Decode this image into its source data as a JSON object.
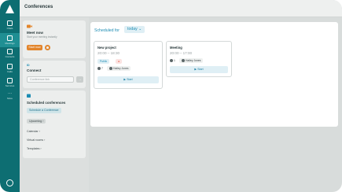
{
  "app": {
    "title": "Conferences"
  },
  "rail": {
    "items": [
      {
        "icon": "chat-icon",
        "label": "Chats"
      },
      {
        "icon": "calendar-icon",
        "label": "Meetings"
      },
      {
        "icon": "contacts-icon",
        "label": "Contacts"
      },
      {
        "icon": "calls-icon",
        "label": "Calls"
      },
      {
        "icon": "clipboard-icon",
        "label": "Services"
      },
      {
        "icon": "more-icon",
        "label": "More"
      }
    ]
  },
  "meet_now": {
    "title": "Meet now",
    "subtitle": "Start your meeting instantly",
    "start_label": "Start now"
  },
  "connect": {
    "id_label": "ID",
    "title": "Connect",
    "placeholder": "Conference link"
  },
  "scheduled": {
    "title": "Scheduled conferences",
    "schedule_button": "Schedule a Conference",
    "categories": [
      {
        "label": "Upcoming",
        "arrow": "›"
      },
      {
        "label": "Calendar",
        "arrow": "›"
      },
      {
        "label": "Virtual rooms",
        "arrow": "›"
      },
      {
        "label": "Templates",
        "arrow": "›"
      }
    ]
  },
  "main": {
    "scheduled_for": "Scheduled for",
    "day_selector": "today ⌄",
    "meetings": [
      {
        "title": "New project",
        "time": "20:00 – 18:30",
        "tags": [
          "Public",
          "●"
        ],
        "participants": "7",
        "organizer": "Hailey Jones",
        "action": "▶  Start"
      },
      {
        "title": "Meeting",
        "time": "20:00 – 17:00",
        "tags": [],
        "participants": "1",
        "organizer": "Hailey Jones",
        "action": "▶  Start"
      }
    ]
  },
  "colors": {
    "rail": "#0d6e72",
    "accent_orange": "#e2852c",
    "accent_blue": "#1c8cb3"
  }
}
